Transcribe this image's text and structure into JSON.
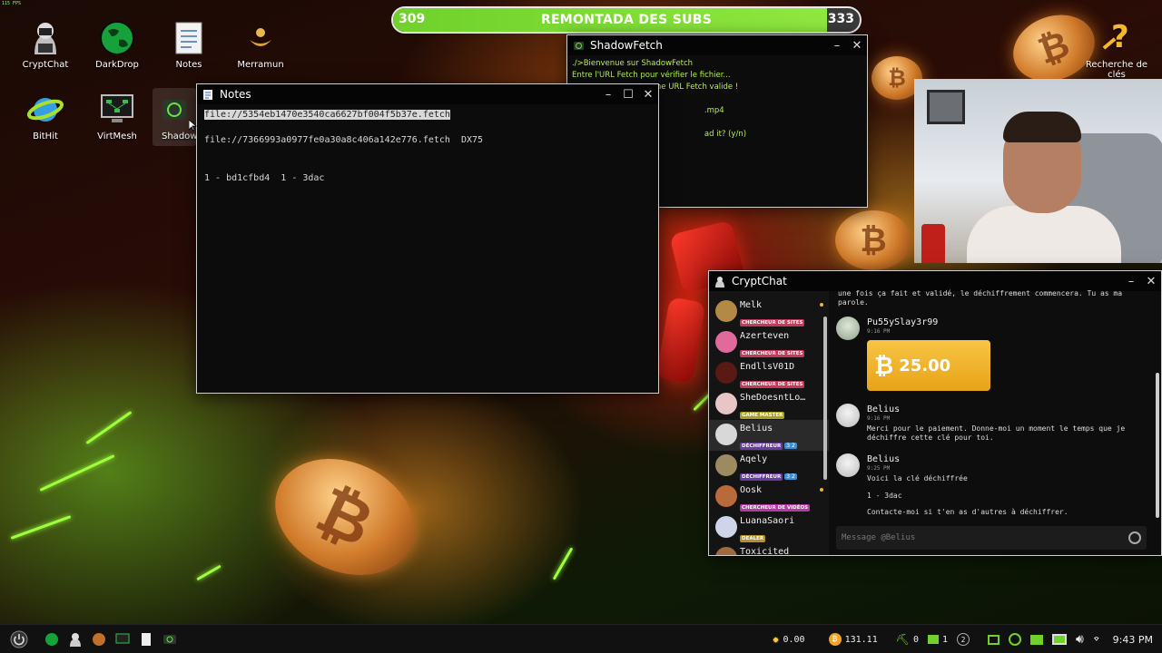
{
  "fps_label": "115 FPS",
  "desktop_icons": [
    {
      "label": "CryptChat"
    },
    {
      "label": "DarkDrop"
    },
    {
      "label": "Notes"
    },
    {
      "label": "Merramun"
    },
    {
      "label": "BitHit"
    },
    {
      "label": "VirtMesh"
    },
    {
      "label": "ShadowF"
    },
    {
      "label": "Recherche de clés"
    }
  ],
  "sub_bar": {
    "left_value": "309",
    "title": "REMONTADA DES SUBS",
    "right_value": "333",
    "progress": 0.93
  },
  "shadowfetch": {
    "title": "ShadowFetch",
    "lines": [
      "./>Bienvenue sur ShadowFetch",
      "Entre l'URL Fetch pour vérifier le fichier...",
      "                           tre une URL Fetch valide !",
      "",
      "                                                      .mp4",
      "",
      "                                                      ad it? (y/n)"
    ]
  },
  "notes": {
    "title": "Notes",
    "lines": [
      {
        "text": "file://5354eb1470e3540ca6627bf004f5b37e.fetch",
        "highlight": true
      },
      {
        "text": "",
        "highlight": false
      },
      {
        "text": "file://7366993a0977fe0a30a8c406a142e776.fetch  DX75",
        "highlight": false
      },
      {
        "text": "",
        "highlight": false
      },
      {
        "text": "",
        "highlight": false
      },
      {
        "text": "1 - bd1cfbd4  1 - 3dac",
        "highlight": false
      }
    ]
  },
  "cryptchat": {
    "title": "CryptChat",
    "users": [
      {
        "name": "Melk",
        "role": "CHERCHEUR DE SITES",
        "role_color": "#c23a5a",
        "level": "",
        "avatar_color": "#b28a45",
        "online": true,
        "selected": false
      },
      {
        "name": "Azerteven",
        "role": "CHERCHEUR DE SITES",
        "role_color": "#c23a5a",
        "level": "",
        "avatar_color": "#e06a9a",
        "online": false,
        "selected": false
      },
      {
        "name": "EndllsV01D",
        "role": "CHERCHEUR DE SITES",
        "role_color": "#c23a5a",
        "level": "",
        "avatar_color": "#5a1a14",
        "online": false,
        "selected": false
      },
      {
        "name": "SheDoesntLo…",
        "role": "GAME MASTER",
        "role_color": "#a8a020",
        "level": "",
        "avatar_color": "#e9c6c6",
        "online": false,
        "selected": false
      },
      {
        "name": "Belius",
        "role": "DÉCHIFFREUR",
        "role_color": "#6a3aa8",
        "level": "3 2",
        "avatar_color": "#d8d8d8",
        "online": false,
        "selected": true
      },
      {
        "name": "Aqely",
        "role": "DÉCHIFFREUR",
        "role_color": "#6a3aa8",
        "level": "3 2",
        "avatar_color": "#9c8a60",
        "online": false,
        "selected": false
      },
      {
        "name": "Oosk",
        "role": "CHERCHEUR DE VIDÉOS",
        "role_color": "#b23aa0",
        "level": "",
        "avatar_color": "#b86a3a",
        "online": true,
        "selected": false
      },
      {
        "name": "LuanaSaori",
        "role": "DEALER",
        "role_color": "#b8902a",
        "level": "",
        "avatar_color": "#d0d4e8",
        "online": false,
        "selected": false
      },
      {
        "name": "Toxicited",
        "role": "",
        "role_color": "#444",
        "level": "",
        "avatar_color": "#a06a40",
        "online": false,
        "selected": false
      }
    ],
    "messages": {
      "top_text_1": "une fois ça fait et validé, le déchiffrement commencera. Tu as ma",
      "top_text_2": "parole.",
      "m1_author": "Pu55ySlay3r99",
      "m1_time": "9:16 PM",
      "m1_amount": "25.00",
      "m2_author": "Belius",
      "m2_time": "9:16 PM",
      "m2_text_1": "Merci pour le paiement. Donne-moi un moment le temps que je",
      "m2_text_2": "déchiffre cette clé pour toi.",
      "m3_author": "Belius",
      "m3_time": "9:25 PM",
      "m3_text_1": "Voici la clé déchiffrée",
      "m3_text_2": "1 - 3dac",
      "m3_text_3": "Contacte-moi si t'en as d'autres à déchiffrer."
    },
    "input_placeholder": "Message @Belius"
  },
  "taskbar": {
    "tray": [
      {
        "icon": "sun-icon",
        "value": "0.00"
      },
      {
        "icon": "bitcoin-icon",
        "value": "131.11"
      },
      {
        "icon": "pickaxe-icon",
        "value": "0"
      },
      {
        "icon": "battery-icon",
        "value": "1"
      },
      {
        "icon": "shield-icon",
        "value": "2"
      }
    ],
    "clock": "9:43 PM"
  }
}
